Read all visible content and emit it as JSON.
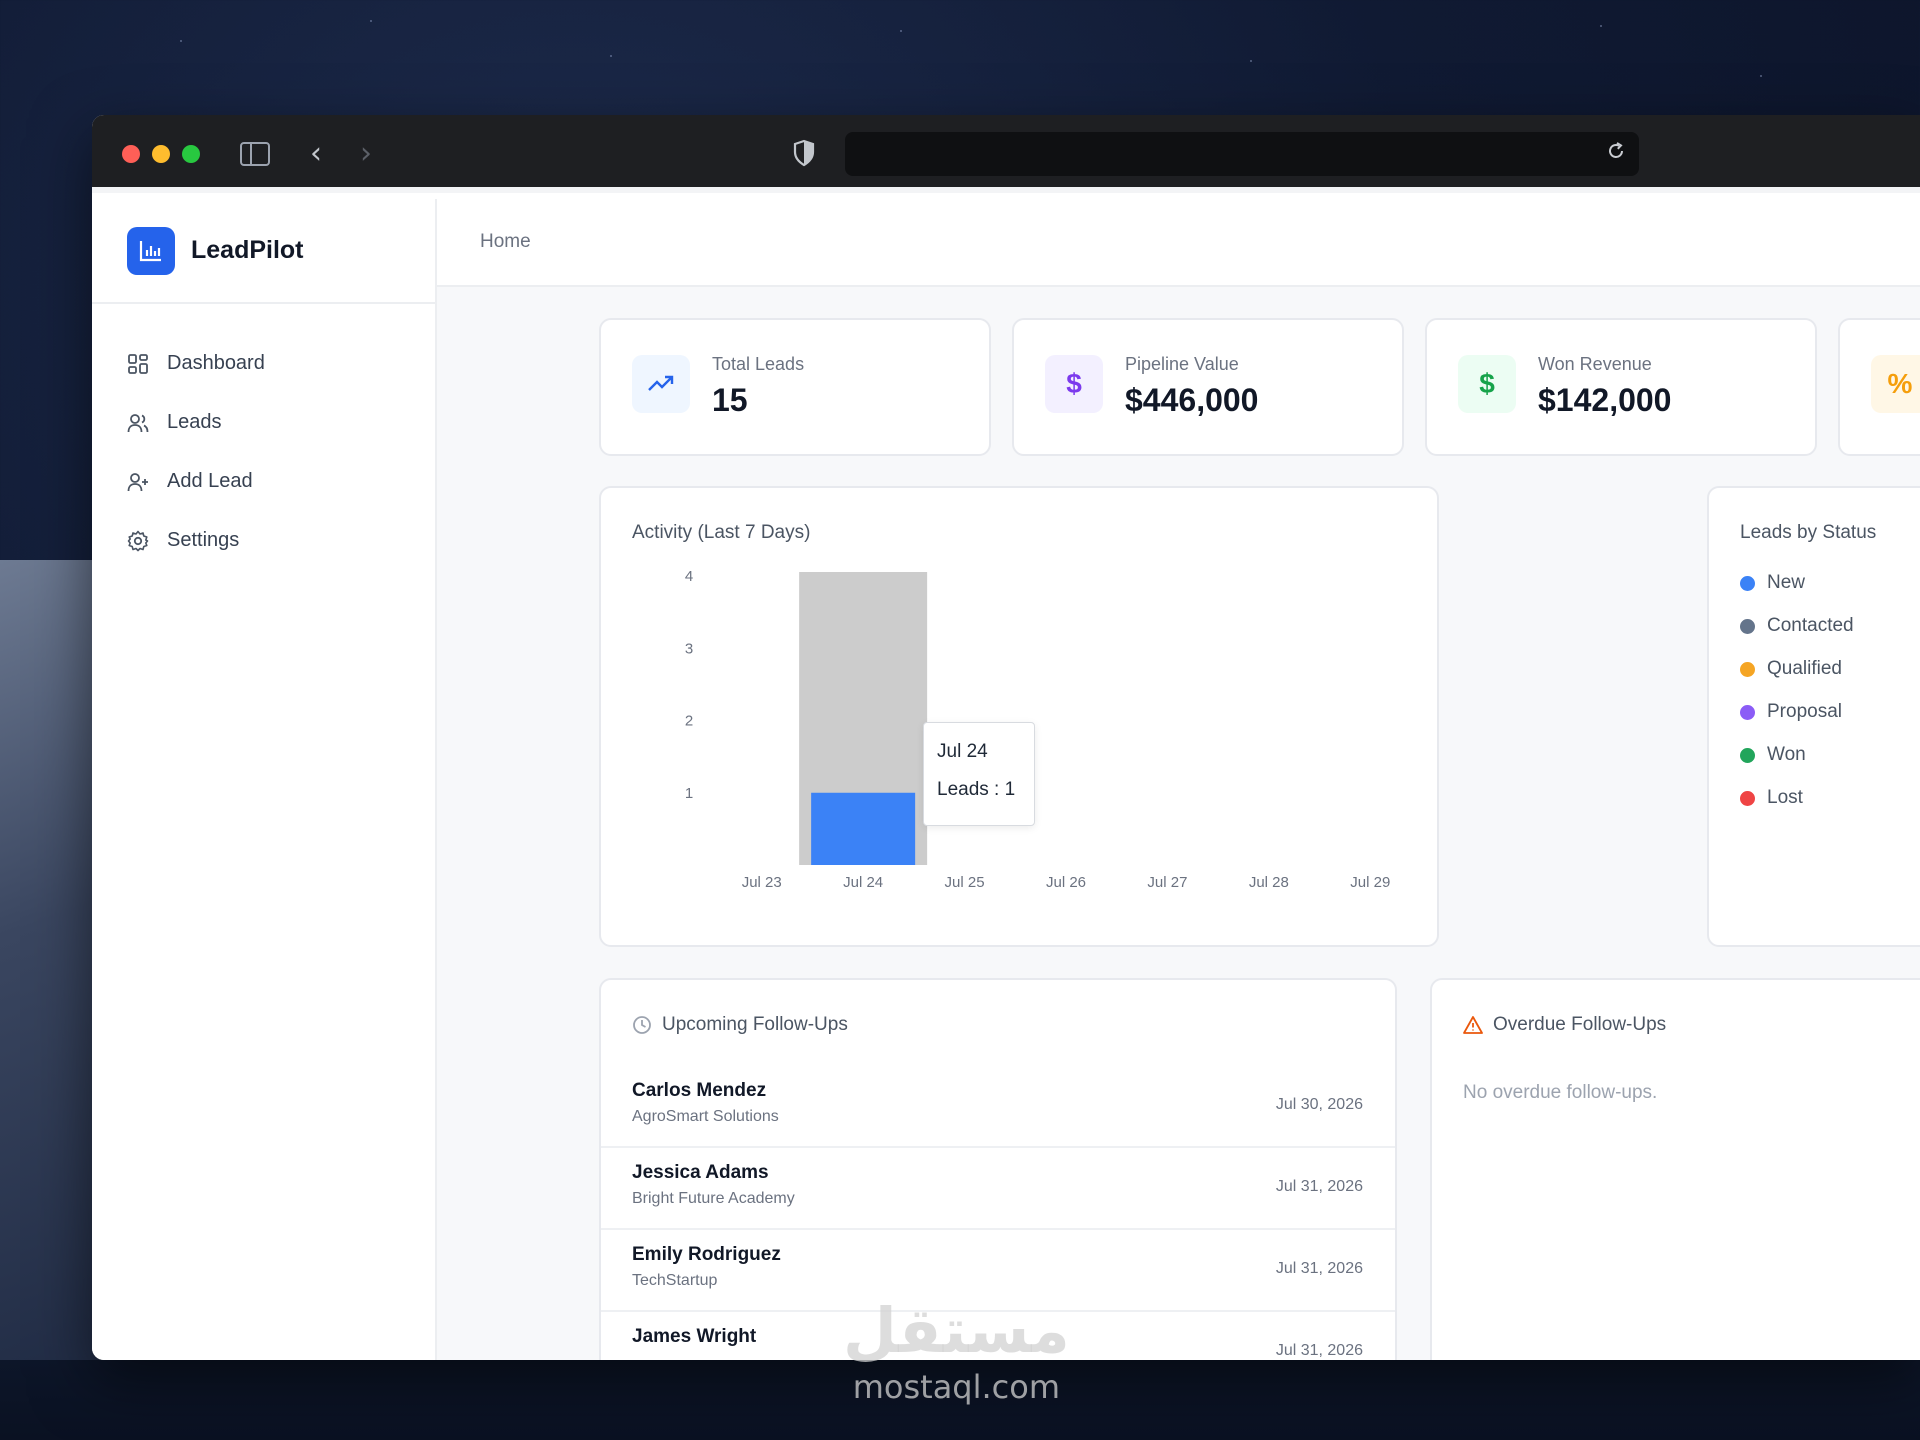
{
  "app": {
    "name": "LeadPilot",
    "breadcrumb": "Home"
  },
  "nav": {
    "items": [
      {
        "label": "Dashboard",
        "icon": "dashboard-icon"
      },
      {
        "label": "Leads",
        "icon": "users-icon"
      },
      {
        "label": "Add Lead",
        "icon": "user-plus-icon"
      },
      {
        "label": "Settings",
        "icon": "gear-icon"
      }
    ]
  },
  "stats": [
    {
      "label": "Total Leads",
      "value": "15",
      "icon": "trending-up-icon",
      "color": "#2563eb",
      "bg": "#eff6ff"
    },
    {
      "label": "Pipeline Value",
      "value": "$446,000",
      "icon": "dollar-icon",
      "color": "#7c3aed",
      "bg": "#f3f0ff"
    },
    {
      "label": "Won Revenue",
      "value": "$142,000",
      "icon": "dollar-icon",
      "color": "#16a34a",
      "bg": "#ecfdf3"
    },
    {
      "label": "",
      "value": "",
      "icon": "percent-icon",
      "color": "#f59e0b",
      "bg": "#fff7e6"
    }
  ],
  "activity": {
    "title": "Activity (Last 7 Days)",
    "tooltip": {
      "date": "Jul 24",
      "text": "Leads : 1"
    }
  },
  "chart_data": {
    "type": "bar",
    "title": "Activity (Last 7 Days)",
    "categories": [
      "Jul 23",
      "Jul 24",
      "Jul 25",
      "Jul 26",
      "Jul 27",
      "Jul 28",
      "Jul 29"
    ],
    "series": [
      {
        "name": "Leads",
        "values": [
          0,
          1,
          0,
          0,
          0,
          0,
          0
        ]
      }
    ],
    "ylim": [
      0,
      4
    ],
    "yticks": [
      0,
      1,
      2,
      3,
      4
    ],
    "highlighted_category": "Jul 24",
    "bar_color": "#3b82f6",
    "highlight_color": "#cccccc",
    "grid": false
  },
  "status": {
    "title": "Leads by Status",
    "items": [
      {
        "label": "New",
        "color": "#3b82f6"
      },
      {
        "label": "Contacted",
        "color": "#64748b"
      },
      {
        "label": "Qualified",
        "color": "#f5a524"
      },
      {
        "label": "Proposal",
        "color": "#8b5cf6"
      },
      {
        "label": "Won",
        "color": "#22a55b"
      },
      {
        "label": "Lost",
        "color": "#ef4444"
      }
    ]
  },
  "upcoming": {
    "title": "Upcoming Follow-Ups",
    "rows": [
      {
        "name": "Carlos Mendez",
        "company": "AgroSmart Solutions",
        "date": "Jul 30, 2026"
      },
      {
        "name": "Jessica Adams",
        "company": "Bright Future Academy",
        "date": "Jul 31, 2026"
      },
      {
        "name": "Emily Rodriguez",
        "company": "TechStartup",
        "date": "Jul 31, 2026"
      },
      {
        "name": "James Wright",
        "company": "",
        "date": "Jul 31, 2026"
      }
    ]
  },
  "overdue": {
    "title": "Overdue Follow-Ups",
    "empty": "No overdue follow-ups."
  },
  "watermark": {
    "arabic": "مستقل",
    "latin": "mostaql.com"
  }
}
